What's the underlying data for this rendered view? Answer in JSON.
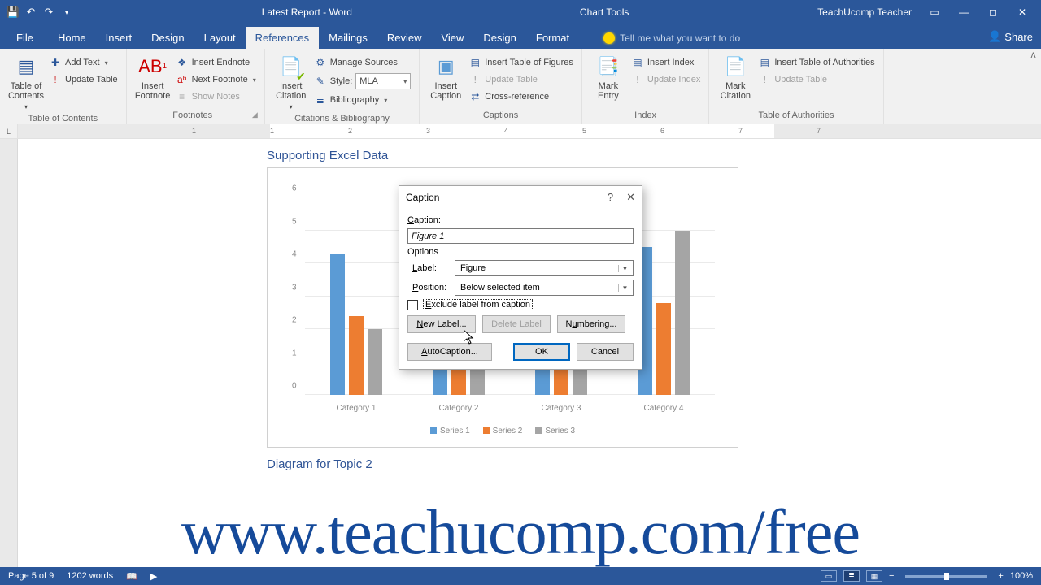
{
  "titlebar": {
    "doc_title": "Latest Report - Word",
    "chart_tools": "Chart Tools",
    "user": "TeachUcomp Teacher"
  },
  "tabs": {
    "file": "File",
    "home": "Home",
    "insert": "Insert",
    "design": "Design",
    "layout": "Layout",
    "references": "References",
    "mailings": "Mailings",
    "review": "Review",
    "view": "View",
    "cdesign": "Design",
    "format": "Format",
    "tellme": "Tell me what you want to do",
    "share": "Share"
  },
  "ribbon": {
    "toc": {
      "big": "Table of Contents",
      "add_text": "Add Text",
      "update_table": "Update Table",
      "group": "Table of Contents"
    },
    "footnotes": {
      "big": "Insert Footnote",
      "insert_endnote": "Insert Endnote",
      "next_footnote": "Next Footnote",
      "show_notes": "Show Notes",
      "group": "Footnotes"
    },
    "cit": {
      "big": "Insert Citation",
      "manage_sources": "Manage Sources",
      "style": "Style:",
      "style_val": "MLA",
      "bibliography": "Bibliography",
      "group": "Citations & Bibliography"
    },
    "captions": {
      "big": "Insert Caption",
      "insert_tof": "Insert Table of Figures",
      "update_table": "Update Table",
      "cross_ref": "Cross-reference",
      "group": "Captions"
    },
    "index": {
      "big": "Mark Entry",
      "insert_index": "Insert Index",
      "update_index": "Update Index",
      "group": "Index"
    },
    "toa": {
      "big": "Mark Citation",
      "insert_toa": "Insert Table of Authorities",
      "update_table": "Update Table",
      "group": "Table of Authorities"
    }
  },
  "doc": {
    "chart_heading": "Supporting Excel Data",
    "diagram_heading": "Diagram for Topic 2"
  },
  "chart_data": {
    "type": "bar",
    "categories": [
      "Category 1",
      "Category 2",
      "Category 3",
      "Category 4"
    ],
    "series": [
      {
        "name": "Series 1",
        "values": [
          4.3,
          2.5,
          3.5,
          4.5
        ]
      },
      {
        "name": "Series 2",
        "values": [
          2.4,
          4.4,
          1.8,
          2.8
        ]
      },
      {
        "name": "Series 3",
        "values": [
          2.0,
          2.0,
          3.0,
          5.0
        ]
      }
    ],
    "ylim": [
      0,
      6
    ],
    "yticks": [
      0,
      1,
      2,
      3,
      4,
      5,
      6
    ]
  },
  "dialog": {
    "title": "Caption",
    "caption_label": "Caption:",
    "caption_value": "Figure 1",
    "options": "Options",
    "label": "Label:",
    "label_val": "Figure",
    "position": "Position:",
    "position_val": "Below selected item",
    "exclude": "Exclude label from caption",
    "new_label": "New Label...",
    "delete_label": "Delete Label",
    "numbering": "Numbering...",
    "autocaption": "AutoCaption...",
    "ok": "OK",
    "cancel": "Cancel"
  },
  "statusbar": {
    "page": "Page 5 of 9",
    "words": "1202 words",
    "zoom": "100%"
  },
  "watermark": "www.teachucomp.com/free"
}
